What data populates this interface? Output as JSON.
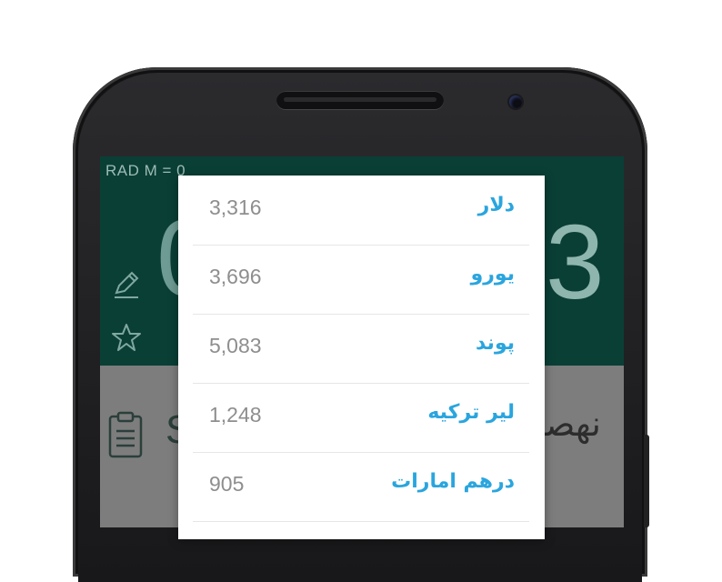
{
  "status_bar": {
    "text": "RAD  M = 0"
  },
  "display": {
    "left_digit": "0",
    "right_digit": "3"
  },
  "history": {
    "left_text": "S",
    "right_text": "نهصد"
  },
  "currency_menu": {
    "items": [
      {
        "name": "دلار",
        "value": "3,316"
      },
      {
        "name": "یورو",
        "value": "3,696"
      },
      {
        "name": "پوند",
        "value": "5,083"
      },
      {
        "name": "لیر ترکیه",
        "value": "1,248"
      },
      {
        "name": "درهم امارات",
        "value": "905"
      }
    ]
  },
  "colors": {
    "accent": "#2aa5de",
    "calc_background": "#0a3f36",
    "value_text": "#8e8e8e"
  },
  "icons": [
    "pencil-icon",
    "star-icon",
    "clipboard-icon",
    "speaker-grille-icon",
    "front-camera-icon"
  ]
}
